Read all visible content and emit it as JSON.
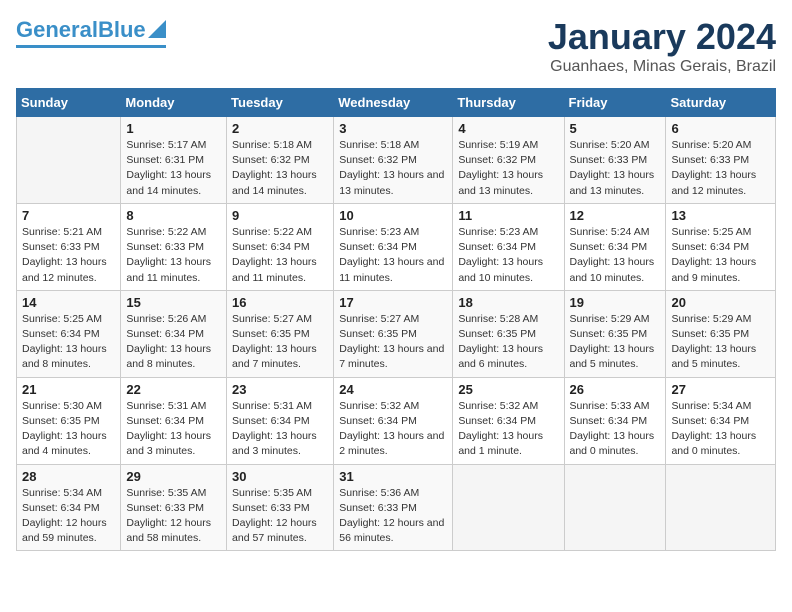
{
  "logo": {
    "part1": "General",
    "part2": "Blue"
  },
  "title": "January 2024",
  "subtitle": "Guanhaes, Minas Gerais, Brazil",
  "headers": [
    "Sunday",
    "Monday",
    "Tuesday",
    "Wednesday",
    "Thursday",
    "Friday",
    "Saturday"
  ],
  "weeks": [
    [
      {
        "num": "",
        "sunrise": "",
        "sunset": "",
        "daylight": ""
      },
      {
        "num": "1",
        "sunrise": "Sunrise: 5:17 AM",
        "sunset": "Sunset: 6:31 PM",
        "daylight": "Daylight: 13 hours and 14 minutes."
      },
      {
        "num": "2",
        "sunrise": "Sunrise: 5:18 AM",
        "sunset": "Sunset: 6:32 PM",
        "daylight": "Daylight: 13 hours and 14 minutes."
      },
      {
        "num": "3",
        "sunrise": "Sunrise: 5:18 AM",
        "sunset": "Sunset: 6:32 PM",
        "daylight": "Daylight: 13 hours and 13 minutes."
      },
      {
        "num": "4",
        "sunrise": "Sunrise: 5:19 AM",
        "sunset": "Sunset: 6:32 PM",
        "daylight": "Daylight: 13 hours and 13 minutes."
      },
      {
        "num": "5",
        "sunrise": "Sunrise: 5:20 AM",
        "sunset": "Sunset: 6:33 PM",
        "daylight": "Daylight: 13 hours and 13 minutes."
      },
      {
        "num": "6",
        "sunrise": "Sunrise: 5:20 AM",
        "sunset": "Sunset: 6:33 PM",
        "daylight": "Daylight: 13 hours and 12 minutes."
      }
    ],
    [
      {
        "num": "7",
        "sunrise": "Sunrise: 5:21 AM",
        "sunset": "Sunset: 6:33 PM",
        "daylight": "Daylight: 13 hours and 12 minutes."
      },
      {
        "num": "8",
        "sunrise": "Sunrise: 5:22 AM",
        "sunset": "Sunset: 6:33 PM",
        "daylight": "Daylight: 13 hours and 11 minutes."
      },
      {
        "num": "9",
        "sunrise": "Sunrise: 5:22 AM",
        "sunset": "Sunset: 6:34 PM",
        "daylight": "Daylight: 13 hours and 11 minutes."
      },
      {
        "num": "10",
        "sunrise": "Sunrise: 5:23 AM",
        "sunset": "Sunset: 6:34 PM",
        "daylight": "Daylight: 13 hours and 11 minutes."
      },
      {
        "num": "11",
        "sunrise": "Sunrise: 5:23 AM",
        "sunset": "Sunset: 6:34 PM",
        "daylight": "Daylight: 13 hours and 10 minutes."
      },
      {
        "num": "12",
        "sunrise": "Sunrise: 5:24 AM",
        "sunset": "Sunset: 6:34 PM",
        "daylight": "Daylight: 13 hours and 10 minutes."
      },
      {
        "num": "13",
        "sunrise": "Sunrise: 5:25 AM",
        "sunset": "Sunset: 6:34 PM",
        "daylight": "Daylight: 13 hours and 9 minutes."
      }
    ],
    [
      {
        "num": "14",
        "sunrise": "Sunrise: 5:25 AM",
        "sunset": "Sunset: 6:34 PM",
        "daylight": "Daylight: 13 hours and 8 minutes."
      },
      {
        "num": "15",
        "sunrise": "Sunrise: 5:26 AM",
        "sunset": "Sunset: 6:34 PM",
        "daylight": "Daylight: 13 hours and 8 minutes."
      },
      {
        "num": "16",
        "sunrise": "Sunrise: 5:27 AM",
        "sunset": "Sunset: 6:35 PM",
        "daylight": "Daylight: 13 hours and 7 minutes."
      },
      {
        "num": "17",
        "sunrise": "Sunrise: 5:27 AM",
        "sunset": "Sunset: 6:35 PM",
        "daylight": "Daylight: 13 hours and 7 minutes."
      },
      {
        "num": "18",
        "sunrise": "Sunrise: 5:28 AM",
        "sunset": "Sunset: 6:35 PM",
        "daylight": "Daylight: 13 hours and 6 minutes."
      },
      {
        "num": "19",
        "sunrise": "Sunrise: 5:29 AM",
        "sunset": "Sunset: 6:35 PM",
        "daylight": "Daylight: 13 hours and 5 minutes."
      },
      {
        "num": "20",
        "sunrise": "Sunrise: 5:29 AM",
        "sunset": "Sunset: 6:35 PM",
        "daylight": "Daylight: 13 hours and 5 minutes."
      }
    ],
    [
      {
        "num": "21",
        "sunrise": "Sunrise: 5:30 AM",
        "sunset": "Sunset: 6:35 PM",
        "daylight": "Daylight: 13 hours and 4 minutes."
      },
      {
        "num": "22",
        "sunrise": "Sunrise: 5:31 AM",
        "sunset": "Sunset: 6:34 PM",
        "daylight": "Daylight: 13 hours and 3 minutes."
      },
      {
        "num": "23",
        "sunrise": "Sunrise: 5:31 AM",
        "sunset": "Sunset: 6:34 PM",
        "daylight": "Daylight: 13 hours and 3 minutes."
      },
      {
        "num": "24",
        "sunrise": "Sunrise: 5:32 AM",
        "sunset": "Sunset: 6:34 PM",
        "daylight": "Daylight: 13 hours and 2 minutes."
      },
      {
        "num": "25",
        "sunrise": "Sunrise: 5:32 AM",
        "sunset": "Sunset: 6:34 PM",
        "daylight": "Daylight: 13 hours and 1 minute."
      },
      {
        "num": "26",
        "sunrise": "Sunrise: 5:33 AM",
        "sunset": "Sunset: 6:34 PM",
        "daylight": "Daylight: 13 hours and 0 minutes."
      },
      {
        "num": "27",
        "sunrise": "Sunrise: 5:34 AM",
        "sunset": "Sunset: 6:34 PM",
        "daylight": "Daylight: 13 hours and 0 minutes."
      }
    ],
    [
      {
        "num": "28",
        "sunrise": "Sunrise: 5:34 AM",
        "sunset": "Sunset: 6:34 PM",
        "daylight": "Daylight: 12 hours and 59 minutes."
      },
      {
        "num": "29",
        "sunrise": "Sunrise: 5:35 AM",
        "sunset": "Sunset: 6:33 PM",
        "daylight": "Daylight: 12 hours and 58 minutes."
      },
      {
        "num": "30",
        "sunrise": "Sunrise: 5:35 AM",
        "sunset": "Sunset: 6:33 PM",
        "daylight": "Daylight: 12 hours and 57 minutes."
      },
      {
        "num": "31",
        "sunrise": "Sunrise: 5:36 AM",
        "sunset": "Sunset: 6:33 PM",
        "daylight": "Daylight: 12 hours and 56 minutes."
      },
      {
        "num": "",
        "sunrise": "",
        "sunset": "",
        "daylight": ""
      },
      {
        "num": "",
        "sunrise": "",
        "sunset": "",
        "daylight": ""
      },
      {
        "num": "",
        "sunrise": "",
        "sunset": "",
        "daylight": ""
      }
    ]
  ]
}
